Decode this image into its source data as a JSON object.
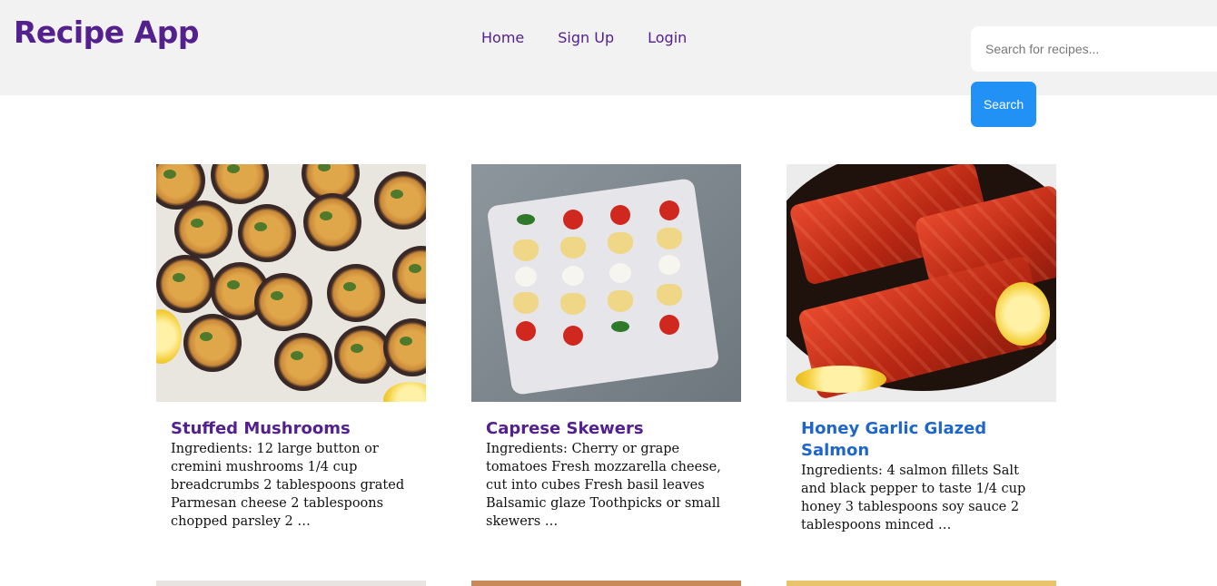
{
  "header": {
    "brand": "Recipe App",
    "nav": [
      "Home",
      "Sign Up",
      "Login"
    ],
    "search_placeholder": "Search for recipes...",
    "search_button": "Search"
  },
  "recipes": [
    {
      "title": "Stuffed Mushrooms",
      "description": "Ingredients: 12 large button or cremini mushrooms 1/4 cup breadcrumbs 2 tablespoons grated Parmesan cheese 2 tablespoons chopped parsley 2 …"
    },
    {
      "title": "Caprese Skewers",
      "description": "Ingredients: Cherry or grape tomatoes Fresh mozzarella cheese, cut into cubes Fresh basil leaves Balsamic glaze Toothpicks or small skewers …"
    },
    {
      "title": "Honey Garlic Glazed Salmon",
      "description": "Ingredients: 4 salmon fillets Salt and black pepper to taste 1/4 cup honey 3 tablespoons soy sauce 2 tablespoons minced …"
    }
  ],
  "colors": {
    "brand": "#53208e",
    "link_blue": "#1f66c9",
    "search_button": "#2191f5",
    "header_bg": "#f2f2f3"
  }
}
